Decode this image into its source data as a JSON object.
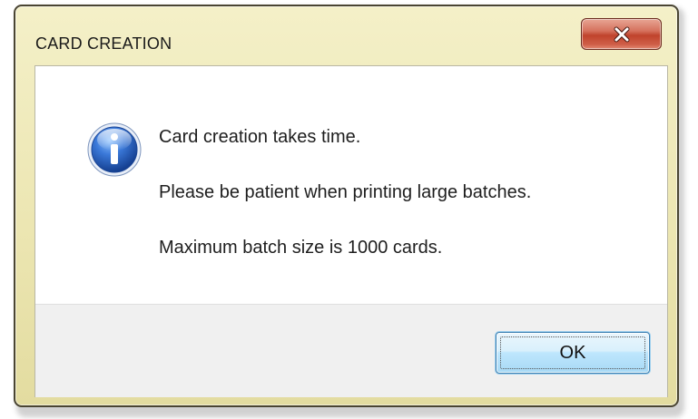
{
  "window": {
    "title": "CARD CREATION",
    "close_icon": "close-icon"
  },
  "message": {
    "icon": "info-icon",
    "lines": [
      "Card creation takes time.",
      "Please be patient when printing large batches.",
      "Maximum batch size is 1000 cards."
    ]
  },
  "buttons": {
    "ok_label": "OK"
  },
  "colors": {
    "frame": "#ece6b2",
    "close_button": "#c0432c",
    "info_icon": "#2a5fb8",
    "ok_button": "#bee6fd",
    "footer": "#f0f0f0"
  }
}
